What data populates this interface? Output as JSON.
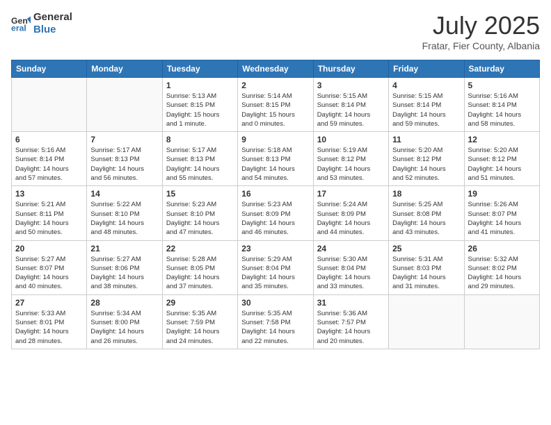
{
  "header": {
    "logo_line1": "General",
    "logo_line2": "Blue",
    "month": "July 2025",
    "location": "Fratar, Fier County, Albania"
  },
  "days_of_week": [
    "Sunday",
    "Monday",
    "Tuesday",
    "Wednesday",
    "Thursday",
    "Friday",
    "Saturday"
  ],
  "weeks": [
    [
      {
        "day": "",
        "info": ""
      },
      {
        "day": "",
        "info": ""
      },
      {
        "day": "1",
        "info": "Sunrise: 5:13 AM\nSunset: 8:15 PM\nDaylight: 15 hours\nand 1 minute."
      },
      {
        "day": "2",
        "info": "Sunrise: 5:14 AM\nSunset: 8:15 PM\nDaylight: 15 hours\nand 0 minutes."
      },
      {
        "day": "3",
        "info": "Sunrise: 5:15 AM\nSunset: 8:14 PM\nDaylight: 14 hours\nand 59 minutes."
      },
      {
        "day": "4",
        "info": "Sunrise: 5:15 AM\nSunset: 8:14 PM\nDaylight: 14 hours\nand 59 minutes."
      },
      {
        "day": "5",
        "info": "Sunrise: 5:16 AM\nSunset: 8:14 PM\nDaylight: 14 hours\nand 58 minutes."
      }
    ],
    [
      {
        "day": "6",
        "info": "Sunrise: 5:16 AM\nSunset: 8:14 PM\nDaylight: 14 hours\nand 57 minutes."
      },
      {
        "day": "7",
        "info": "Sunrise: 5:17 AM\nSunset: 8:13 PM\nDaylight: 14 hours\nand 56 minutes."
      },
      {
        "day": "8",
        "info": "Sunrise: 5:17 AM\nSunset: 8:13 PM\nDaylight: 14 hours\nand 55 minutes."
      },
      {
        "day": "9",
        "info": "Sunrise: 5:18 AM\nSunset: 8:13 PM\nDaylight: 14 hours\nand 54 minutes."
      },
      {
        "day": "10",
        "info": "Sunrise: 5:19 AM\nSunset: 8:12 PM\nDaylight: 14 hours\nand 53 minutes."
      },
      {
        "day": "11",
        "info": "Sunrise: 5:20 AM\nSunset: 8:12 PM\nDaylight: 14 hours\nand 52 minutes."
      },
      {
        "day": "12",
        "info": "Sunrise: 5:20 AM\nSunset: 8:12 PM\nDaylight: 14 hours\nand 51 minutes."
      }
    ],
    [
      {
        "day": "13",
        "info": "Sunrise: 5:21 AM\nSunset: 8:11 PM\nDaylight: 14 hours\nand 50 minutes."
      },
      {
        "day": "14",
        "info": "Sunrise: 5:22 AM\nSunset: 8:10 PM\nDaylight: 14 hours\nand 48 minutes."
      },
      {
        "day": "15",
        "info": "Sunrise: 5:23 AM\nSunset: 8:10 PM\nDaylight: 14 hours\nand 47 minutes."
      },
      {
        "day": "16",
        "info": "Sunrise: 5:23 AM\nSunset: 8:09 PM\nDaylight: 14 hours\nand 46 minutes."
      },
      {
        "day": "17",
        "info": "Sunrise: 5:24 AM\nSunset: 8:09 PM\nDaylight: 14 hours\nand 44 minutes."
      },
      {
        "day": "18",
        "info": "Sunrise: 5:25 AM\nSunset: 8:08 PM\nDaylight: 14 hours\nand 43 minutes."
      },
      {
        "day": "19",
        "info": "Sunrise: 5:26 AM\nSunset: 8:07 PM\nDaylight: 14 hours\nand 41 minutes."
      }
    ],
    [
      {
        "day": "20",
        "info": "Sunrise: 5:27 AM\nSunset: 8:07 PM\nDaylight: 14 hours\nand 40 minutes."
      },
      {
        "day": "21",
        "info": "Sunrise: 5:27 AM\nSunset: 8:06 PM\nDaylight: 14 hours\nand 38 minutes."
      },
      {
        "day": "22",
        "info": "Sunrise: 5:28 AM\nSunset: 8:05 PM\nDaylight: 14 hours\nand 37 minutes."
      },
      {
        "day": "23",
        "info": "Sunrise: 5:29 AM\nSunset: 8:04 PM\nDaylight: 14 hours\nand 35 minutes."
      },
      {
        "day": "24",
        "info": "Sunrise: 5:30 AM\nSunset: 8:04 PM\nDaylight: 14 hours\nand 33 minutes."
      },
      {
        "day": "25",
        "info": "Sunrise: 5:31 AM\nSunset: 8:03 PM\nDaylight: 14 hours\nand 31 minutes."
      },
      {
        "day": "26",
        "info": "Sunrise: 5:32 AM\nSunset: 8:02 PM\nDaylight: 14 hours\nand 29 minutes."
      }
    ],
    [
      {
        "day": "27",
        "info": "Sunrise: 5:33 AM\nSunset: 8:01 PM\nDaylight: 14 hours\nand 28 minutes."
      },
      {
        "day": "28",
        "info": "Sunrise: 5:34 AM\nSunset: 8:00 PM\nDaylight: 14 hours\nand 26 minutes."
      },
      {
        "day": "29",
        "info": "Sunrise: 5:35 AM\nSunset: 7:59 PM\nDaylight: 14 hours\nand 24 minutes."
      },
      {
        "day": "30",
        "info": "Sunrise: 5:35 AM\nSunset: 7:58 PM\nDaylight: 14 hours\nand 22 minutes."
      },
      {
        "day": "31",
        "info": "Sunrise: 5:36 AM\nSunset: 7:57 PM\nDaylight: 14 hours\nand 20 minutes."
      },
      {
        "day": "",
        "info": ""
      },
      {
        "day": "",
        "info": ""
      }
    ]
  ]
}
